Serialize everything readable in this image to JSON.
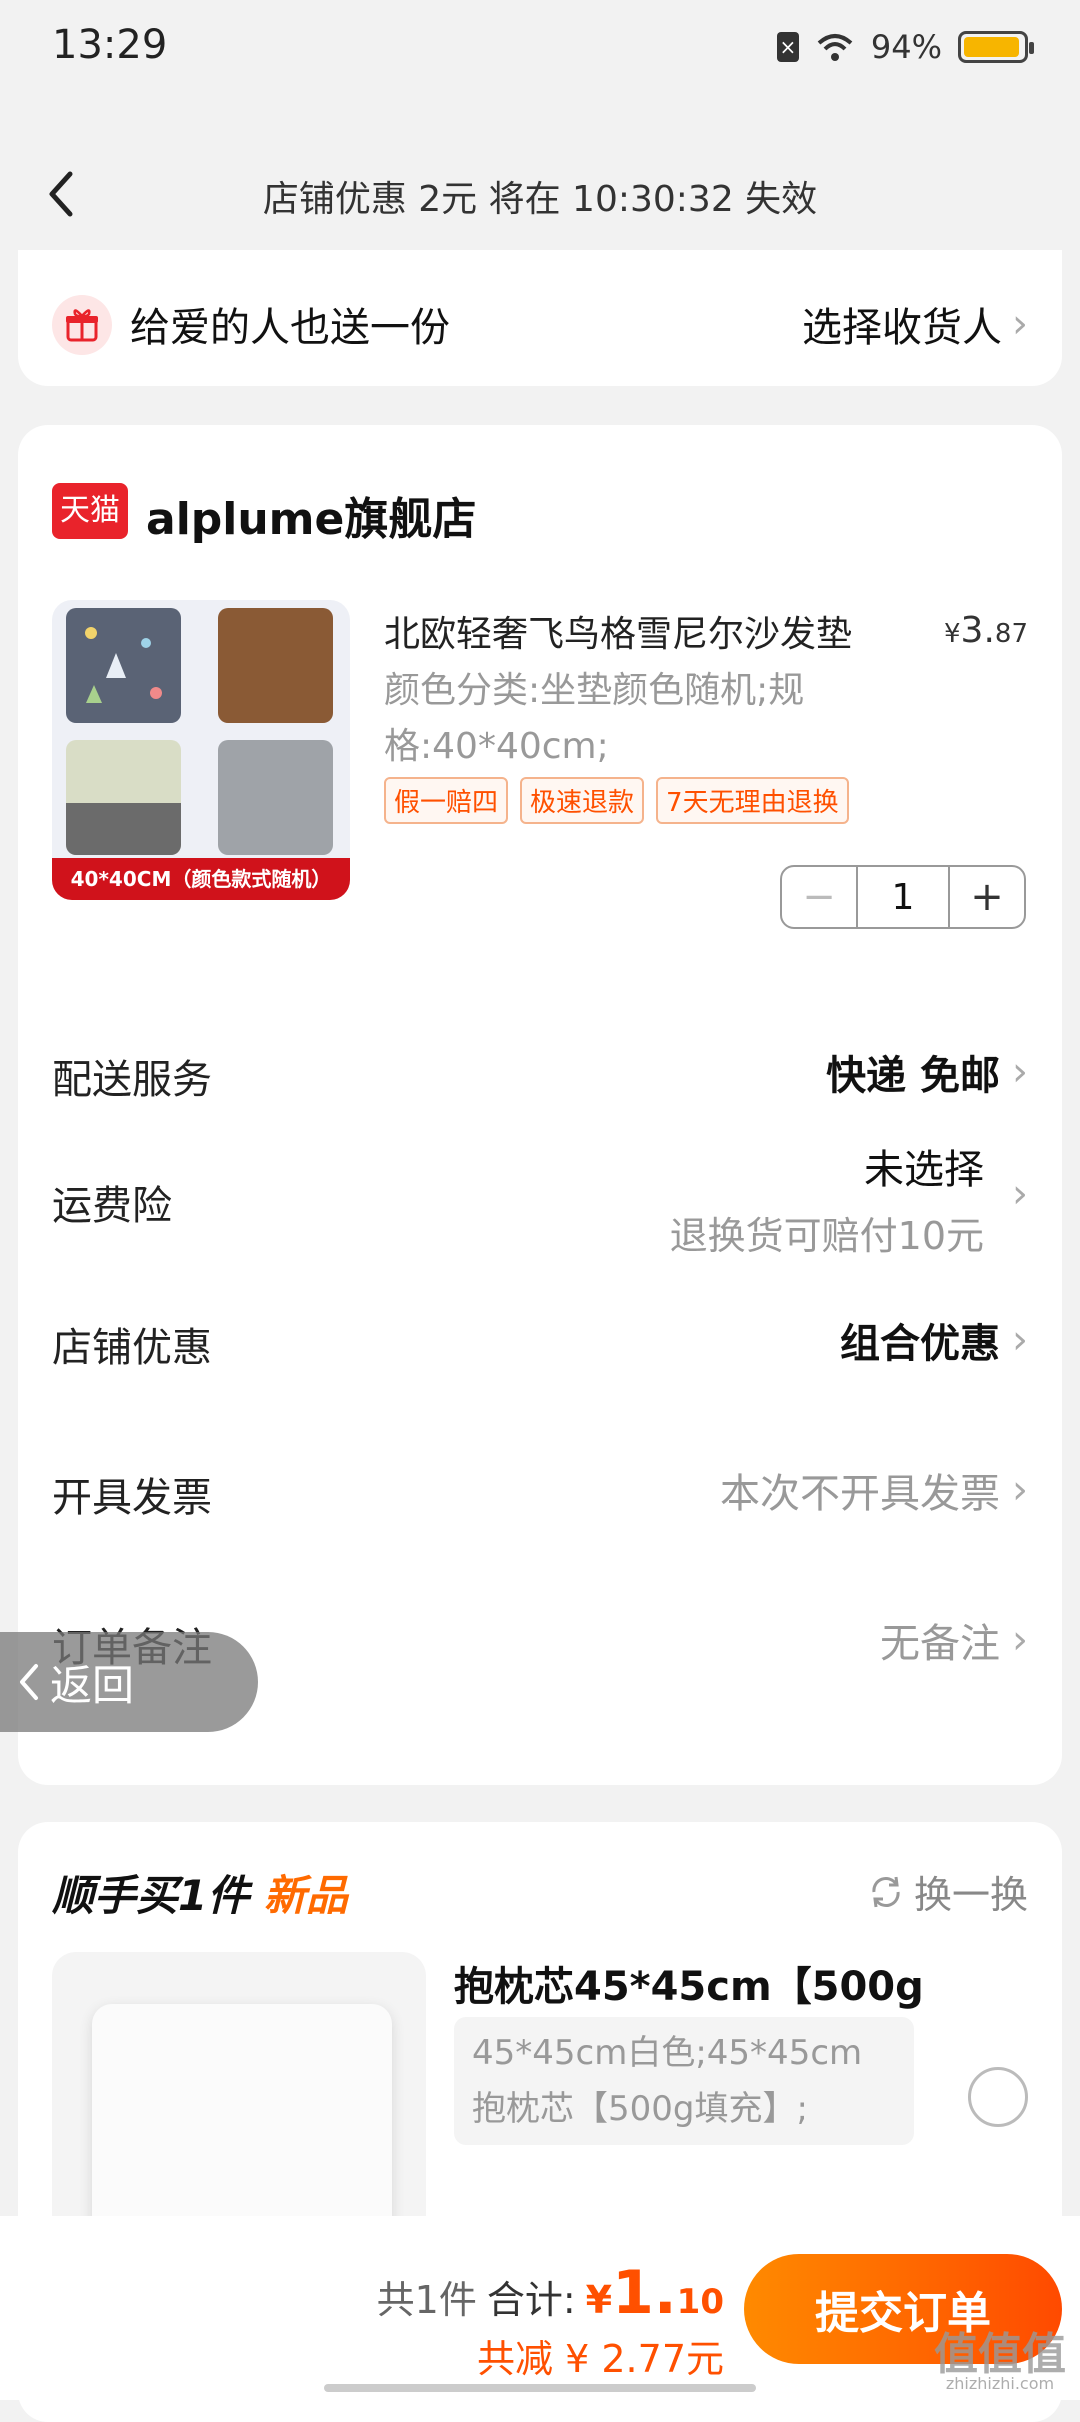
{
  "status_bar": {
    "time": "13:29",
    "battery": "94%",
    "battery_level": 0.94,
    "sim_icon": "sim-off-icon",
    "wifi_icon": "wifi-icon"
  },
  "nav": {
    "title": "店铺优惠 2元 将在 10:30:32 失效"
  },
  "gift": {
    "text": "给爱的人也送一份",
    "action": "选择收货人"
  },
  "store": {
    "badge": "天猫",
    "name": "alplume旗舰店",
    "product": {
      "title": "北欧轻奢飞鸟格雪尼尔沙发垫",
      "price_symbol": "¥",
      "price_int": "3.",
      "price_dec": "87",
      "attrs": "颜色分类:坐垫颜色随机;规格:40*40cm;",
      "image_banner": "40*40CM（颜色款式随机）",
      "tags": [
        "假一赔四",
        "极速退款",
        "7天无理由退换"
      ],
      "quantity": "1"
    },
    "rows": [
      {
        "label": "配送服务",
        "value": "快递 免邮"
      },
      {
        "label": "运费险",
        "value": "未选择",
        "sub": "退换货可赔付10元"
      },
      {
        "label": "店铺优惠",
        "value": "组合优惠"
      },
      {
        "label": "开具发票",
        "value": "本次不开具发票"
      },
      {
        "label": "订单备注",
        "value": "无备注"
      }
    ]
  },
  "float_back": {
    "label": "返回"
  },
  "extra": {
    "title": "顺手买1件",
    "title_new": "新品",
    "swap": "换一换",
    "item_name": "抱枕芯45*45cm【500g",
    "item_attrs": "45*45cm白色;45*45cm抱枕芯【500g填充】;"
  },
  "bottom": {
    "count": "共1件",
    "total_label": "合计:",
    "total_symbol": "¥",
    "total_int": "1.",
    "total_dec": "10",
    "discount": "共减 ¥ 2.77元",
    "submit": "提交订单"
  },
  "watermark": {
    "main": "值值值",
    "sub": "zhizhizhi.com"
  },
  "colors": {
    "accent": "#ff5000",
    "brand_red": "#e9232b"
  }
}
